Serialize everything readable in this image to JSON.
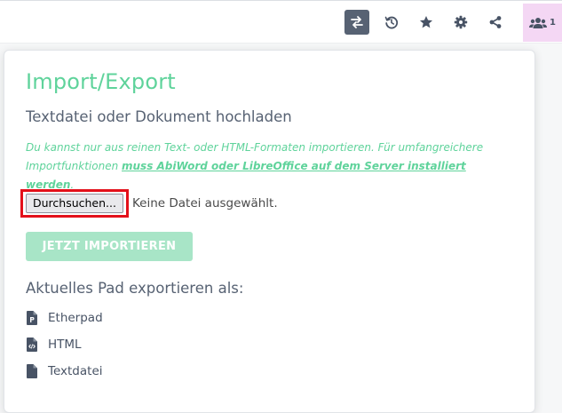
{
  "toolbar": {
    "buttons": [
      {
        "icon": "import-export-icon",
        "active": true
      },
      {
        "icon": "history-icon",
        "active": false
      },
      {
        "icon": "star-icon",
        "active": false
      },
      {
        "icon": "gear-icon",
        "active": false
      },
      {
        "icon": "share-icon",
        "active": false
      }
    ],
    "users": {
      "icon": "users-icon",
      "count": "1"
    }
  },
  "popup": {
    "title": "Import/Export",
    "import_heading": "Textdatei oder Dokument hochladen",
    "notice_text": "Du kannst nur aus reinen Text- oder HTML-Formaten importieren. Für umfangreichere Importfunktionen ",
    "notice_link": "muss AbiWord oder LibreOffice auf dem Server installiert werden",
    "notice_end": ".",
    "browse_label": "Durchsuchen...",
    "no_file_text": "Keine Datei ausgewählt.",
    "import_button": "JETZT IMPORTIEREN",
    "export_heading": "Aktuelles Pad exportieren als:",
    "export_options": [
      {
        "label": "Etherpad",
        "icon": "etherpad-file-icon"
      },
      {
        "label": "HTML",
        "icon": "html-file-icon"
      },
      {
        "label": "Textdatei",
        "icon": "text-file-icon"
      }
    ]
  },
  "colors": {
    "accent": "#5fd39b",
    "active_toolbar": "#576273",
    "text": "#576273",
    "highlight": "#e3101a",
    "users_bg": "#f4d7f4"
  }
}
